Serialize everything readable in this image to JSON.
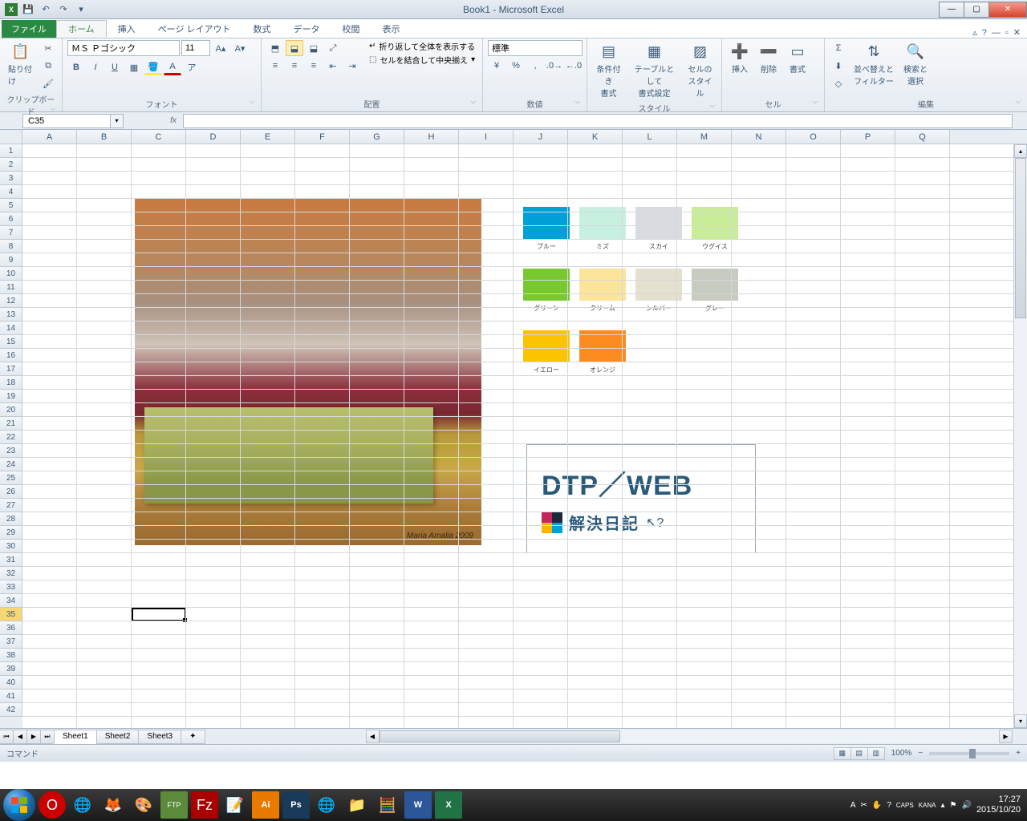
{
  "title": "Book1 - Microsoft Excel",
  "tabs": {
    "file": "ファイル",
    "home": "ホーム",
    "insert": "挿入",
    "layout": "ページ レイアウト",
    "formulas": "数式",
    "data": "データ",
    "review": "校閲",
    "view": "表示"
  },
  "ribbon": {
    "clipboard": {
      "paste": "貼り付け",
      "label": "クリップボード"
    },
    "font": {
      "name": "ＭＳ Ｐゴシック",
      "size": "11",
      "label": "フォント"
    },
    "align": {
      "wrap": "折り返して全体を表示する",
      "merge": "セルを結合して中央揃え",
      "label": "配置"
    },
    "number": {
      "format": "標準",
      "label": "数値"
    },
    "styles": {
      "cond": "条件付き\n書式",
      "table": "テーブルとして\n書式設定",
      "cell": "セルの\nスタイル",
      "label": "スタイル"
    },
    "cells": {
      "insert": "挿入",
      "delete": "削除",
      "format": "書式",
      "label": "セル"
    },
    "editing": {
      "sort": "並べ替えと\nフィルター",
      "find": "検索と\n選択",
      "label": "編集"
    }
  },
  "namebox": "C35",
  "columns": [
    "A",
    "B",
    "C",
    "D",
    "E",
    "F",
    "G",
    "H",
    "I",
    "J",
    "K",
    "L",
    "M",
    "N",
    "O",
    "P",
    "Q"
  ],
  "rows": 42,
  "selected": {
    "col": 2,
    "row": 35
  },
  "swatches": [
    [
      {
        "c": "#00a0d8",
        "n": "ブルー"
      },
      {
        "c": "#c8f0e0",
        "n": "ミズ"
      },
      {
        "c": "#d8dce0",
        "n": "スカイ"
      },
      {
        "c": "#c8ec98",
        "n": "ウグイス"
      }
    ],
    [
      {
        "c": "#78c830",
        "n": "グリーン"
      },
      {
        "c": "#fce49a",
        "n": "クリーム"
      },
      {
        "c": "#e4e0d0",
        "n": "シルバー"
      },
      {
        "c": "#c8ccc0",
        "n": "グレー"
      }
    ],
    [
      {
        "c": "#fcc400",
        "n": "イエロー"
      },
      {
        "c": "#fc8c20",
        "n": "オレンジ"
      }
    ]
  ],
  "logo": {
    "title": "DTP／WEB",
    "sub": "解決日記"
  },
  "painting_sig": "Maria Amalia 2009",
  "sheets": [
    "Sheet1",
    "Sheet2",
    "Sheet3"
  ],
  "status": {
    "mode": "コマンド",
    "zoom": "100%"
  },
  "tray": {
    "ime": "A",
    "caps": "CAPS",
    "kana": "KANA",
    "time": "17:27",
    "date": "2015/10/20"
  }
}
